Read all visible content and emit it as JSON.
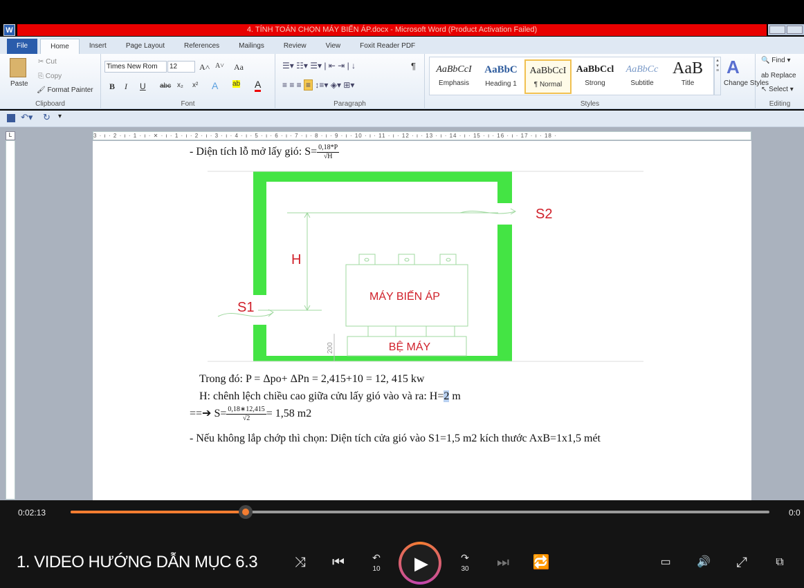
{
  "window": {
    "title": "4. TÍNH TOÁN CHỌN MÁY BIẾN ÁP.docx - Microsoft Word (Product Activation Failed)",
    "app_icon": "W"
  },
  "tabs": [
    "File",
    "Home",
    "Insert",
    "Page Layout",
    "References",
    "Mailings",
    "Review",
    "View",
    "Foxit Reader PDF"
  ],
  "ribbon": {
    "clipboard": {
      "paste": "Paste",
      "cut": "Cut",
      "copy": "Copy",
      "format_painter": "Format Painter",
      "label": "Clipboard"
    },
    "font": {
      "name": "Times New Rom",
      "size": "12",
      "label": "Font",
      "bold": "B",
      "italic": "I",
      "underline": "U",
      "strike": "abc",
      "sub": "x₂",
      "sup": "x²",
      "grow": "A˄",
      "shrink": "A˅",
      "case": "Aa"
    },
    "paragraph": {
      "label": "Paragraph",
      "pilcrow": "¶"
    },
    "styles": {
      "label": "Styles",
      "items": [
        {
          "preview": "AaBbCcI",
          "name": "Emphasis"
        },
        {
          "preview": "AaBbC",
          "name": "Heading 1"
        },
        {
          "preview": "AaBbCcI",
          "name": "¶ Normal"
        },
        {
          "preview": "AaBbCcl",
          "name": "Strong"
        },
        {
          "preview": "AaBbCc",
          "name": "Subtitle"
        },
        {
          "preview": "AaB",
          "name": "Title"
        }
      ],
      "selected": "¶ Normal",
      "change_styles": "Change Styles"
    },
    "editing": {
      "label": "Editing",
      "find": "Find",
      "replace": "Replace",
      "select": "Select"
    }
  },
  "ruler": "3 · ı · 2 · ı · 1 · ı · ✕ · ı · 1 · ı · 2 · ı · 3 · ı · 4 · ı · 5 · ı · 6 · ı · 7 · ı · 8 · ı · 9 · ı · 10 · ı · 11 · ı · 12 · ı · 13 · ı · 14 · ı · 15 · ı · 16 · ı · 17 · ı · 18 ·",
  "document": {
    "line1_prefix": "- Diện tích lỗ mở lấy gió: S=",
    "line1_num": "0,18*P",
    "line1_den": "√H",
    "diagram": {
      "s1": "S1",
      "s2": "S2",
      "h": "H",
      "transformer": "MÁY BIẾN ÁP",
      "base": "BỆ MÁY",
      "dim": "200",
      "wall_color": "#44e444",
      "label_color": "#d0202a"
    },
    "line2": "Trong đó: P = Δpo+ ΔPn = 2,415+10 = 12, 415 kw",
    "line3_prefix": "H: chênh lệch chiều cao giữa cửu lấy gió vào và ra: H=",
    "line3_value": "2",
    "line3_suffix": " m",
    "line4_arrow": "==➔ S=",
    "line4_num": "0,18∗12,415",
    "line4_den": "√2",
    "line4_result": "= 1,58 m2",
    "line5": "- Nếu không lắp chớp thì chọn: Diện tích cửa gió vào S1=1,5 m2 kích thước AxB=1x1,5 mét"
  },
  "player": {
    "title": "1. VIDEO HƯỚNG DẪN MỤC 6.3",
    "current_time": "0:02:13",
    "end_time": "0:0",
    "progress_percent": 25,
    "accent": "#f37d31",
    "controls": [
      "shuffle-icon",
      "previous-icon",
      "rewind-10-icon",
      "play-icon",
      "forward-30-icon",
      "next-icon",
      "repeat-off-icon",
      "subtitles-icon",
      "volume-icon",
      "fullscreen-icon",
      "mini-player-icon"
    ],
    "rewind_label": "10",
    "forward_label": "30"
  }
}
